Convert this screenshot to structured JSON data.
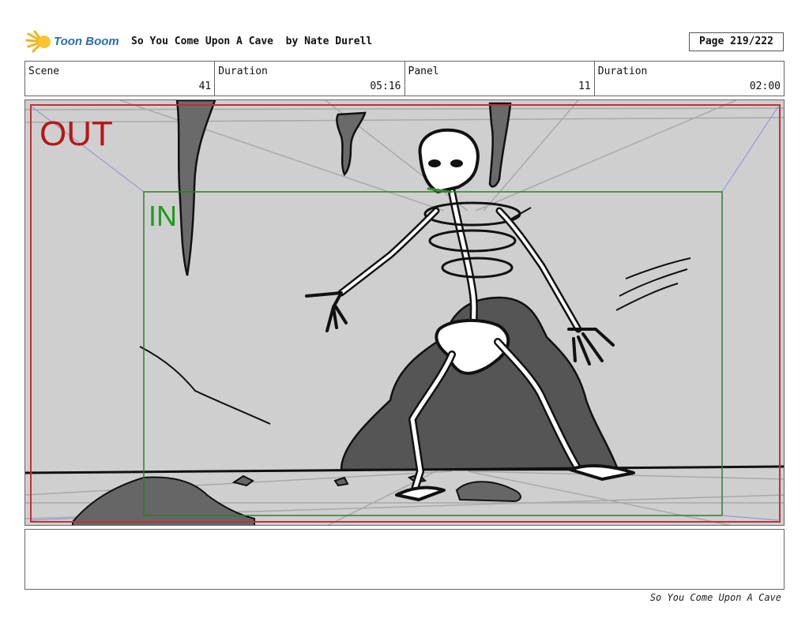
{
  "header": {
    "logo_text": "Toon Boom",
    "title": "So You Come Upon A Cave  by Nate Durell",
    "page": "Page 219/222"
  },
  "info": {
    "scene_label": "Scene",
    "scene_value": "41",
    "duration_label": "Duration",
    "duration_value": "05:16",
    "panel_label": "Panel",
    "panel_value": "11",
    "panel_duration_label": "Duration",
    "panel_duration_value": "02:00"
  },
  "frame": {
    "out_label": "OUT",
    "in_label": "IN",
    "out_color": "#b81616",
    "in_color": "#1f9a1f"
  },
  "notes": {
    "text": ""
  },
  "footer": {
    "text": "So You Come Upon A Cave"
  }
}
